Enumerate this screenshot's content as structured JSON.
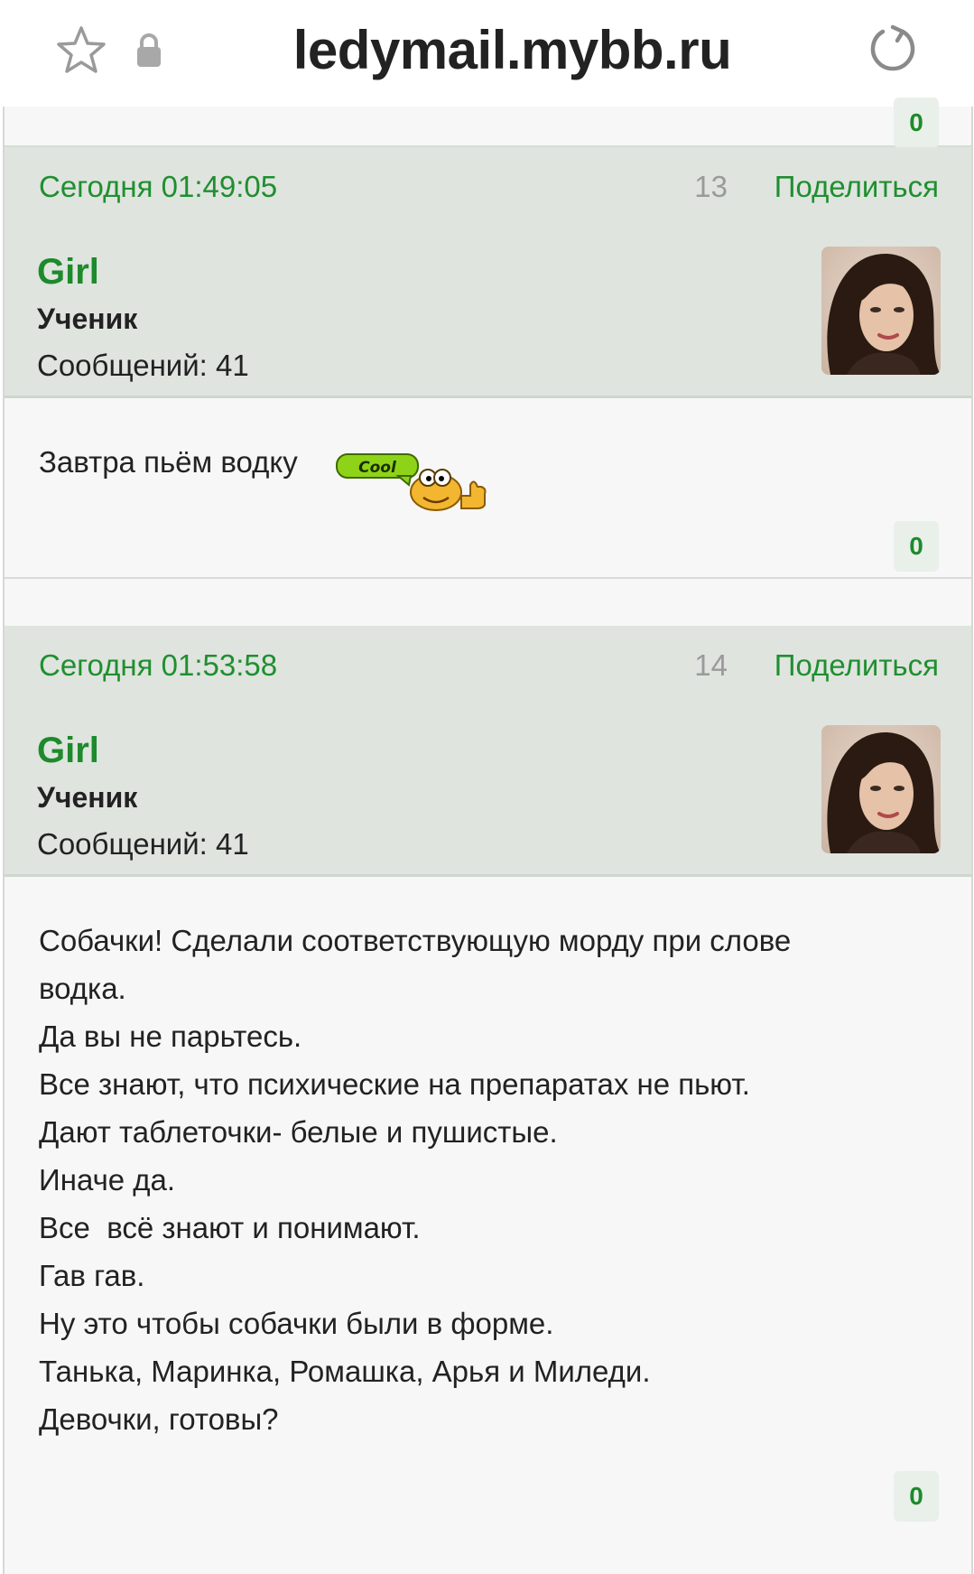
{
  "browser": {
    "url": "ledymail.mybb.ru",
    "icons": [
      "star-icon",
      "lock-icon",
      "reload-icon"
    ]
  },
  "previous_post": {
    "likes": "0"
  },
  "posts": [
    {
      "date": "Сегодня 01:49:05",
      "number": "13",
      "share_label": "Поделиться",
      "author": "Girl",
      "rank": "Ученик",
      "post_count": "Сообщений: 41",
      "text_lines": [
        "Завтра пьём водку"
      ],
      "smiley_text": "Cool",
      "likes": "0"
    },
    {
      "date": "Сегодня 01:53:58",
      "number": "14",
      "share_label": "Поделиться",
      "author": "Girl",
      "rank": "Ученик",
      "post_count": "Сообщений: 41",
      "text_lines": [
        "Собачки! Сделали соответствующую морду при слове",
        "водка.",
        "Да вы не парьтесь.",
        "Все знают, что психические на препаратах не пьют.",
        "Дают таблеточки- белые и пушистые.",
        "Иначе да.",
        "Все  всё знают и понимают.",
        "Гав гав.",
        "Ну это чтобы собачки были в форме.",
        "Танька, Маринка, Ромашка, Арья и Миледи.",
        "Девочки, готовы?"
      ],
      "likes": "0"
    }
  ],
  "colors": {
    "accent_green": "#1f8f2f",
    "header_bg": "#dfe4df",
    "body_bg": "#f7f7f7"
  }
}
